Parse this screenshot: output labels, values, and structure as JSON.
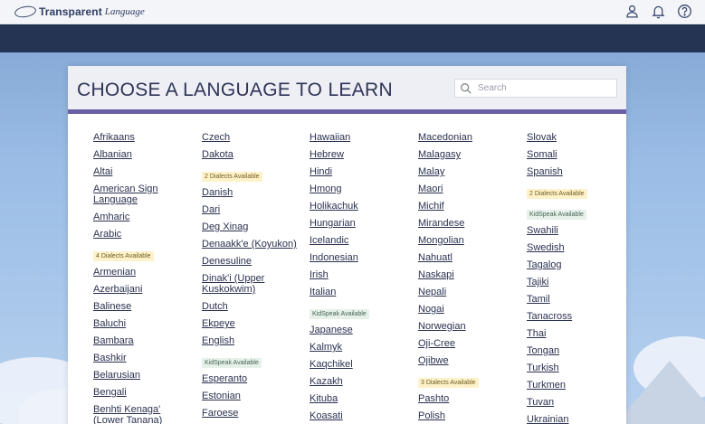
{
  "header": {
    "logo_main": "Transparent",
    "logo_sub": "Language",
    "icons": [
      "profile-icon",
      "bell-icon",
      "help-icon"
    ]
  },
  "panel": {
    "title": "CHOOSE A LANGUAGE TO LEARN",
    "search_placeholder": "Search"
  },
  "columns": [
    {
      "items": [
        {
          "label": "Afrikaans"
        },
        {
          "label": "Albanian"
        },
        {
          "label": "Altai"
        },
        {
          "label": "American Sign Language"
        },
        {
          "label": "Amharic"
        },
        {
          "label": "Arabic",
          "badges": [
            {
              "type": "dialect",
              "text": "4 Dialects Available"
            }
          ]
        },
        {
          "label": "Armenian"
        },
        {
          "label": "Azerbaijani"
        },
        {
          "label": "Balinese"
        },
        {
          "label": "Baluchi"
        },
        {
          "label": "Bambara"
        },
        {
          "label": "Bashkir"
        },
        {
          "label": "Belarusian"
        },
        {
          "label": "Bengali"
        },
        {
          "label": "Benhti Kenaga' (Lower Tanana)"
        }
      ]
    },
    {
      "items": [
        {
          "label": "Czech"
        },
        {
          "label": "Dakota",
          "badges": [
            {
              "type": "dialect",
              "text": "2 Dialects Available"
            }
          ]
        },
        {
          "label": "Danish"
        },
        {
          "label": "Dari"
        },
        {
          "label": "Deg Xinag"
        },
        {
          "label": "Denaakk'e (Koyukon)"
        },
        {
          "label": "Denesuline"
        },
        {
          "label": "Dinak'i (Upper Kuskokwim)"
        },
        {
          "label": "Dutch"
        },
        {
          "label": "Ekpeye"
        },
        {
          "label": "English",
          "badges": [
            {
              "type": "kid",
              "text": "KidSpeak Available"
            }
          ]
        },
        {
          "label": "Esperanto"
        },
        {
          "label": "Estonian"
        },
        {
          "label": "Faroese"
        }
      ]
    },
    {
      "items": [
        {
          "label": "Hawaiian"
        },
        {
          "label": "Hebrew"
        },
        {
          "label": "Hindi"
        },
        {
          "label": "Hmong"
        },
        {
          "label": "Holikachuk"
        },
        {
          "label": "Hungarian"
        },
        {
          "label": "Icelandic"
        },
        {
          "label": "Indonesian"
        },
        {
          "label": "Irish"
        },
        {
          "label": "Italian",
          "badges": [
            {
              "type": "kid",
              "text": "KidSpeak Available"
            }
          ]
        },
        {
          "label": "Japanese"
        },
        {
          "label": "Kalmyk"
        },
        {
          "label": "Kaqchikel"
        },
        {
          "label": "Kazakh"
        },
        {
          "label": "Kituba"
        },
        {
          "label": "Koasati"
        }
      ]
    },
    {
      "items": [
        {
          "label": "Macedonian"
        },
        {
          "label": "Malagasy"
        },
        {
          "label": "Malay"
        },
        {
          "label": "Maori"
        },
        {
          "label": "Michif"
        },
        {
          "label": "Mirandese"
        },
        {
          "label": "Mongolian"
        },
        {
          "label": "Nahuatl"
        },
        {
          "label": "Naskapi"
        },
        {
          "label": "Nepali"
        },
        {
          "label": "Nogai"
        },
        {
          "label": "Norwegian"
        },
        {
          "label": "Oji-Cree"
        },
        {
          "label": "Ojibwe",
          "badges": [
            {
              "type": "dialect",
              "text": "3 Dialects Available"
            }
          ]
        },
        {
          "label": "Pashto"
        },
        {
          "label": "Polish"
        }
      ]
    },
    {
      "items": [
        {
          "label": "Slovak"
        },
        {
          "label": "Somali"
        },
        {
          "label": "Spanish",
          "badges": [
            {
              "type": "dialect",
              "text": "2 Dialects Available"
            },
            {
              "type": "kid",
              "text": "KidSpeak Available"
            }
          ]
        },
        {
          "label": "Swahili"
        },
        {
          "label": "Swedish"
        },
        {
          "label": "Tagalog"
        },
        {
          "label": "Tajiki"
        },
        {
          "label": "Tamil"
        },
        {
          "label": "Tanacross"
        },
        {
          "label": "Thai"
        },
        {
          "label": "Tongan"
        },
        {
          "label": "Turkish"
        },
        {
          "label": "Turkmen"
        },
        {
          "label": "Tuvan"
        },
        {
          "label": "Ukrainian"
        }
      ]
    }
  ]
}
